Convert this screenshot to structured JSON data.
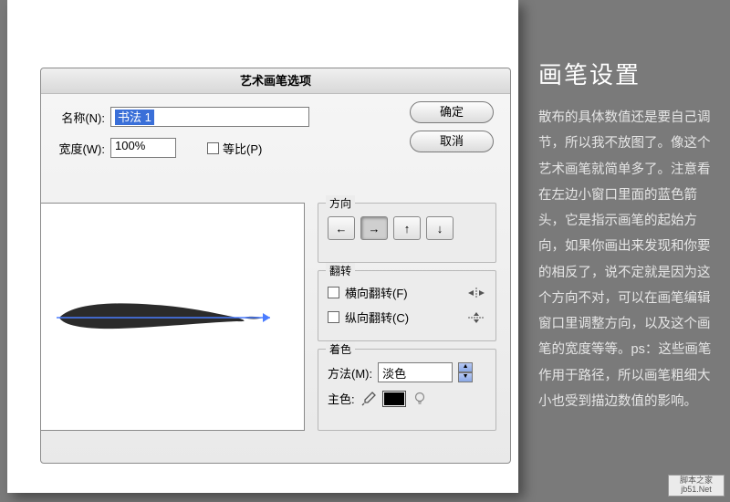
{
  "dialog": {
    "title": "艺术画笔选项",
    "name_label": "名称(N):",
    "name_value": "书法 1",
    "width_label": "宽度(W):",
    "width_value": "100%",
    "proportional_label": "等比(P)",
    "ok": "确定",
    "cancel": "取消"
  },
  "direction": {
    "legend": "方向",
    "left": "←",
    "right": "→",
    "up": "↑",
    "down": "↓"
  },
  "flip": {
    "legend": "翻转",
    "horizontal": "横向翻转(F)",
    "vertical": "纵向翻转(C)"
  },
  "colorize": {
    "legend": "着色",
    "method_label": "方法(M):",
    "method_value": "淡色",
    "key_label": "主色:"
  },
  "sidebar": {
    "heading": "画笔设置",
    "body": "散布的具体数值还是要自己调节，所以我不放图了。像这个艺术画笔就简单多了。注意看在左边小窗口里面的蓝色箭头，它是指示画笔的起始方向，如果你画出来发现和你要的相反了，说不定就是因为这个方向不对，可以在画笔编辑窗口里调整方向，以及这个画笔的宽度等等。ps：这些画笔作用于路径，所以画笔粗细大小也受到描边数值的影响。"
  },
  "watermark": {
    "line1": "脚本之家",
    "line2": "jb51.Net"
  }
}
